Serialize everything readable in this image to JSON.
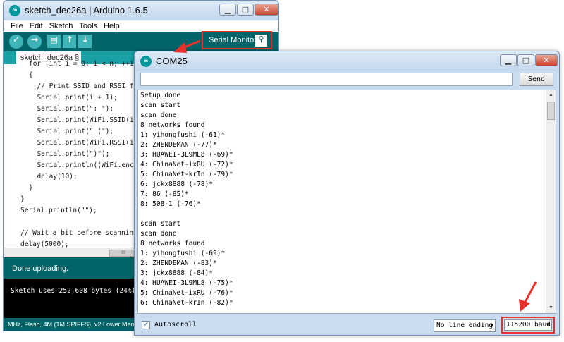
{
  "ide": {
    "title": "sketch_dec26a | Arduino 1.6.5",
    "menu": [
      "File",
      "Edit",
      "Sketch",
      "Tools",
      "Help"
    ],
    "tab_label": "sketch_dec26a §",
    "code_lines": [
      "for (int i = 0; i < n; ++i)",
      "{",
      "  // Print SSID and RSSI for each",
      "  Serial.print(i + 1);",
      "  Serial.print(\": \");",
      "  Serial.print(WiFi.SSID(i));",
      "  Serial.print(\" (\");",
      "  Serial.print(WiFi.RSSI(i));",
      "  Serial.print(\")\");",
      "  Serial.println((WiFi.encryptio",
      "  delay(10);",
      "}",
      "}",
      "Serial.println(\"\");",
      "",
      "// Wait a bit before scanning again",
      "delay(5000);",
      "}"
    ],
    "status": "Done uploading.",
    "console": "Sketch uses 252,608 bytes (24%) of pro",
    "board_info": "MHz, Flash, 4M (1M SPIFFS), v2 Lower Memory",
    "serial_monitor_label": "Serial Monitor",
    "scroll_marker": "III"
  },
  "com": {
    "title": "COM25",
    "send_label": "Send",
    "send_value": "",
    "output": [
      "Setup done",
      "scan start",
      "scan done",
      "8 networks found",
      "1: yihongfushi (-61)*",
      "2: ZHENDEMAN (-77)*",
      "3: HUAWEI-3L9ML8 (-69)*",
      "4: ChinaNet-ixRU (-72)*",
      "5: ChinaNet-krIn (-79)*",
      "6: jckx8888 (-78)*",
      "7: 86 (-85)*",
      "8: 508-1 (-76)*",
      "",
      "scan start",
      "scan done",
      "8 networks found",
      "1: yihongfushi (-69)*",
      "2: ZHENDEMAN (-83)*",
      "3: jckx8888 (-84)*",
      "4: HUAWEI-3L9ML8 (-75)*",
      "5: ChinaNet-ixRU (-76)*",
      "6: ChinaNet-krIn (-82)*"
    ],
    "autoscroll_label": "Autoscroll",
    "autoscroll_checked": true,
    "line_ending": "No line ending",
    "baud": "115200 baud"
  },
  "icons": {
    "verify": "✓",
    "upload": "→",
    "new": "▤",
    "open": "↑",
    "save": "↓",
    "magnifier": "⚲",
    "minimize": "▁",
    "maximize": "□",
    "close": "✕",
    "dropdown": "▼",
    "check": "✓",
    "scroll_up": "▲",
    "scroll_down": "▼"
  },
  "colors": {
    "arduino_teal": "#006468",
    "highlight_red": "#e8312a"
  }
}
